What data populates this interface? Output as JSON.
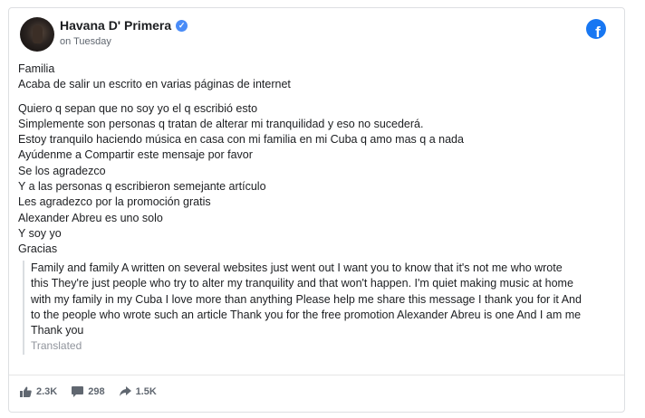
{
  "post": {
    "page_name": "Havana D' Primera",
    "time": "on Tuesday",
    "lines_a": [
      "Familia",
      "Acaba de salir un escrito en varias páginas de internet"
    ],
    "lines_b": [
      "Quiero q sepan que no soy yo el q escribió esto",
      "Simplemente son personas q tratan de alterar mi tranquilidad y eso no sucederá.",
      "Estoy tranquilo haciendo música en casa con mi familia en mi Cuba q amo mas q a nada",
      "Ayúdenme a Compartir este mensaje por favor",
      "Se los agradezco",
      "Y a las personas q escribieron semejante artículo",
      "Les agradezco por la promoción gratis",
      "Alexander Abreu es uno solo",
      "Y soy yo",
      "Gracias"
    ],
    "translation_lines": [
      "Family and family A written on several websites just went out I want you to know that it's not me who wrote",
      "this They're just people who try to alter my tranquility and that won't happen. I'm quiet making music at home",
      "with my family in my Cuba I love more than anything Please help me share this message I thank you for it And",
      "to the people who wrote such an article Thank you for the free promotion Alexander Abreu is one And I am me",
      "Thank you"
    ],
    "translated_label": "Translated"
  },
  "stats": {
    "likes": "2.3K",
    "comments": "298",
    "shares": "1.5K"
  },
  "icons": {
    "brand": "facebook-icon",
    "verified": "verified-badge-icon",
    "like": "thumbs-up-icon",
    "comment": "comment-icon",
    "share": "share-arrow-icon"
  },
  "colors": {
    "brand": "#1877f2",
    "verified": "#4a8cf7",
    "muted_text": "#606770"
  }
}
